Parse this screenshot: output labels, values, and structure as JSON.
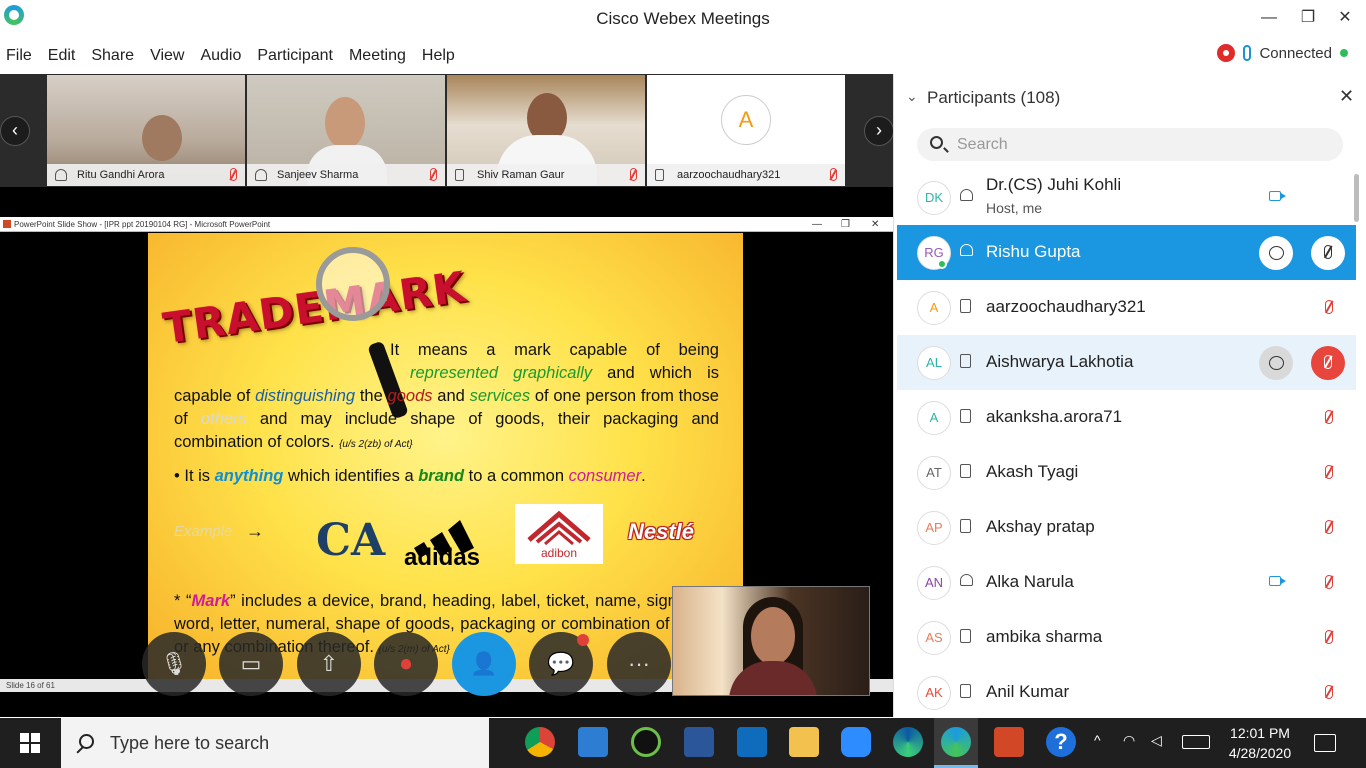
{
  "window": {
    "title": "Cisco Webex Meetings",
    "minimize_label": "—",
    "restore_label": "❐",
    "close_label": "✕"
  },
  "menu": [
    "File",
    "Edit",
    "Share",
    "View",
    "Audio",
    "Participant",
    "Meeting",
    "Help"
  ],
  "status": {
    "connection": "Connected"
  },
  "filmstrip": {
    "prev_label": "‹",
    "next_label": "›",
    "tiles": [
      {
        "name": "Ritu Gandhi Arora",
        "device": "headset"
      },
      {
        "name": "Sanjeev Sharma",
        "device": "headset"
      },
      {
        "name": "Shiv Raman Gaur",
        "device": "phone"
      },
      {
        "name": "aarzoochaudhary321",
        "device": "phone",
        "avatar": "A"
      }
    ]
  },
  "ppt": {
    "window_title": "PowerPoint Slide Show - [IPR ppt 20190104 RG] - Microsoft PowerPoint",
    "status": "Slide 16 of 61",
    "slide": {
      "logo_text": "TRADEMARK",
      "para1": {
        "t1": "It means a mark capable of being",
        "t2": "represented graphically",
        "t3": "and which is capable of",
        "t4": "distinguishing",
        "t5": "the",
        "t6": "goods",
        "t7": "and",
        "t8": "services",
        "t9": "of one person from those of",
        "t10": "others",
        "t11": "and may include shape of goods, their packaging and combination of colors.",
        "ref": "{u/s 2(zb) of Act}"
      },
      "bullet": {
        "t1": "• It is",
        "t2": "anything",
        "t3": "which identifies a",
        "t4": "brand",
        "t5": "to a common",
        "t6": "consumer",
        "t7": "."
      },
      "example_label": "Example",
      "example_arrow": "→",
      "logos": {
        "ca": "CA",
        "adidas": "adidas",
        "adibon": "adibon",
        "nestle": "Nestlé"
      },
      "para3": {
        "t1": "* “",
        "t2": "Mark",
        "t3": "” includes a device, brand, heading, label, ticket, name, signature, word, letter, numeral, shape of goods, packaging or combination of colors or any combination thereof.",
        "ref": "{u/s 2(m) of Act}"
      }
    }
  },
  "controls": [
    {
      "name": "mute",
      "glyph": "🎙"
    },
    {
      "name": "video",
      "glyph": "▭"
    },
    {
      "name": "share",
      "glyph": "⇧"
    },
    {
      "name": "record",
      "glyph": "⏺"
    },
    {
      "name": "participants",
      "glyph": "👤"
    },
    {
      "name": "chat",
      "glyph": "💬"
    },
    {
      "name": "more",
      "glyph": "···"
    }
  ],
  "participants_panel": {
    "title": "Participants (108)",
    "search_placeholder": "Search",
    "list": [
      {
        "initials": "DK",
        "name": "Dr.(CS) Juhi Kohli",
        "sub": "Host, me",
        "device": "headset",
        "video": true,
        "color": "#2bb5a8"
      },
      {
        "initials": "RG",
        "name": "Rishu Gupta",
        "device": "headset",
        "color": "#9b59b6",
        "selected": true
      },
      {
        "initials": "A",
        "name": "aarzoochaudhary321",
        "device": "phone",
        "muted": true,
        "color": "#f29b14"
      },
      {
        "initials": "AL",
        "name": "Aishwarya Lakhotia",
        "device": "phone",
        "color": "#2bb5a8",
        "hover": true
      },
      {
        "initials": "A",
        "name": "akanksha.arora71",
        "device": "phone",
        "muted": true,
        "color": "#2bb5a8"
      },
      {
        "initials": "AT",
        "name": "Akash Tyagi",
        "device": "phone",
        "muted": true,
        "color": "#666666"
      },
      {
        "initials": "AP",
        "name": "Akshay pratap",
        "device": "phone",
        "muted": true,
        "color": "#e67e5a"
      },
      {
        "initials": "AN",
        "name": "Alka Narula",
        "device": "headset",
        "video": true,
        "muted": true,
        "color": "#8e44ad"
      },
      {
        "initials": "AS",
        "name": "ambika sharma",
        "device": "phone",
        "muted": true,
        "color": "#e67e5a"
      },
      {
        "initials": "AK",
        "name": "Anil Kumar",
        "device": "phone",
        "muted": true,
        "color": "#e74c3c"
      }
    ]
  },
  "taskbar": {
    "search_text": "Type here to search",
    "time": "12:01 PM",
    "date": "4/28/2020",
    "help_glyph": "?"
  }
}
